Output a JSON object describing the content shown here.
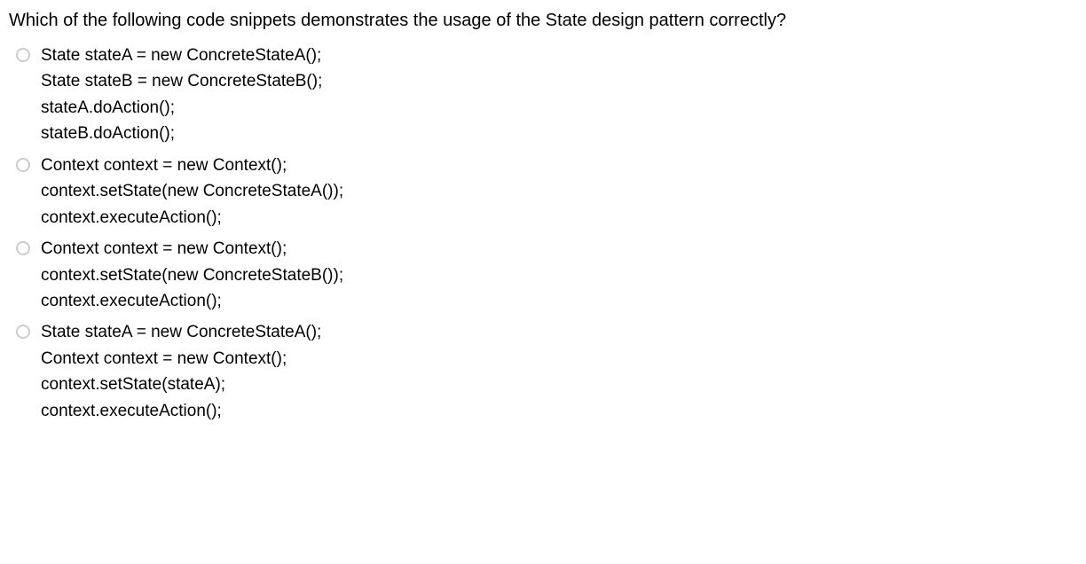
{
  "question": "Which of the following code snippets demonstrates the usage of the State design pattern correctly?",
  "options": [
    {
      "lines": [
        "State stateA = new ConcreteStateA();",
        "State stateB = new ConcreteStateB();",
        "stateA.doAction();",
        "stateB.doAction();"
      ]
    },
    {
      "lines": [
        "Context context = new Context();",
        "context.setState(new ConcreteStateA());",
        "context.executeAction();"
      ]
    },
    {
      "lines": [
        "Context context = new Context();",
        "context.setState(new ConcreteStateB());",
        "context.executeAction();"
      ]
    },
    {
      "lines": [
        "State stateA = new ConcreteStateA();",
        "Context context = new Context();",
        "context.setState(stateA);",
        "context.executeAction();"
      ]
    }
  ]
}
